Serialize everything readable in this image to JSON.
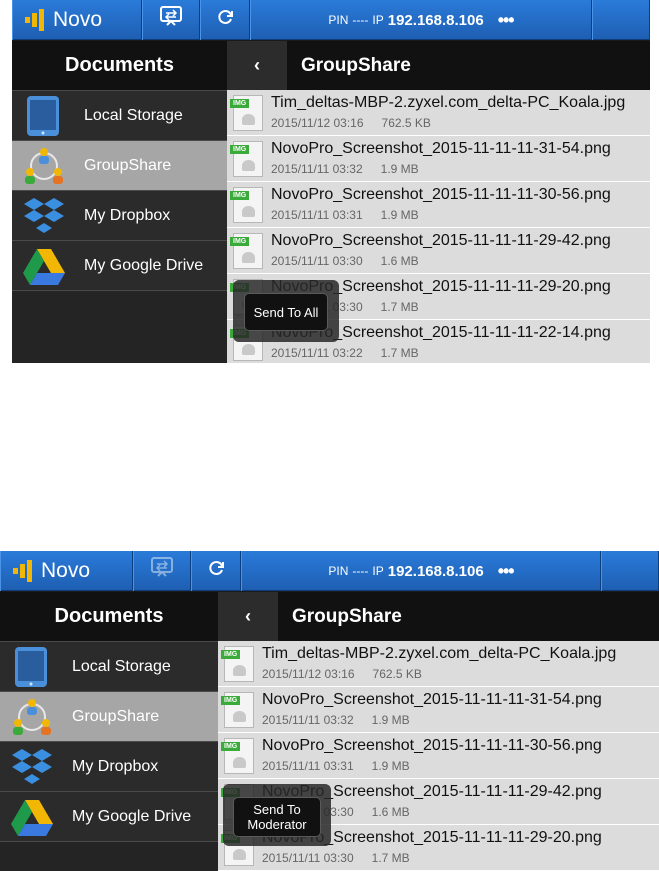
{
  "shots": [
    {
      "app_name": "Novo",
      "status": {
        "pin_label": "PIN",
        "pin_value": "----",
        "ip_label": "IP",
        "ip_value": "192.168.8.106",
        "more": "•••"
      },
      "sidebar": {
        "title": "Documents",
        "items": [
          {
            "label": "Local Storage",
            "icon": "tablet-icon",
            "selected": false
          },
          {
            "label": "GroupShare",
            "icon": "group-share-icon",
            "selected": true
          },
          {
            "label": "My Dropbox",
            "icon": "dropbox-icon",
            "selected": false
          },
          {
            "label": "My Google Drive",
            "icon": "google-drive-icon",
            "selected": false
          }
        ]
      },
      "main": {
        "back": "‹",
        "title": "GroupShare",
        "files": [
          {
            "name": "Tim_deltas-MBP-2.zyxel.com_delta-PC_Koala.jpg",
            "date": "2015/11/12 03:16",
            "size": "762.5 KB"
          },
          {
            "name": "NovoPro_Screenshot_2015-11-11-11-31-54.png",
            "date": "2015/11/11 03:32",
            "size": "1.9 MB"
          },
          {
            "name": "NovoPro_Screenshot_2015-11-11-11-30-56.png",
            "date": "2015/11/11 03:31",
            "size": "1.9 MB"
          },
          {
            "name": "NovoPro_Screenshot_2015-11-11-11-29-42.png",
            "date": "2015/11/11 03:30",
            "size": "1.6 MB"
          },
          {
            "name": "NovoPro_Screenshot_2015-11-11-11-29-20.png",
            "date": "2015/11/11 03:30",
            "size": "1.7 MB"
          },
          {
            "name": "NovoPro_Screenshot_2015-11-11-11-22-14.png",
            "date": "2015/11/11 03:22",
            "size": "1.7 MB"
          }
        ]
      },
      "popup_label": "Send To All"
    },
    {
      "app_name": "Novo",
      "status": {
        "pin_label": "PIN",
        "pin_value": "----",
        "ip_label": "IP",
        "ip_value": "192.168.8.106",
        "more": "•••"
      },
      "sidebar": {
        "title": "Documents",
        "items": [
          {
            "label": "Local Storage",
            "icon": "tablet-icon",
            "selected": false
          },
          {
            "label": "GroupShare",
            "icon": "group-share-icon",
            "selected": true
          },
          {
            "label": "My Dropbox",
            "icon": "dropbox-icon",
            "selected": false
          },
          {
            "label": "My Google Drive",
            "icon": "google-drive-icon",
            "selected": false
          }
        ]
      },
      "main": {
        "back": "‹",
        "title": "GroupShare",
        "files": [
          {
            "name": "Tim_deltas-MBP-2.zyxel.com_delta-PC_Koala.jpg",
            "date": "2015/11/12 03:16",
            "size": "762.5 KB"
          },
          {
            "name": "NovoPro_Screenshot_2015-11-11-11-31-54.png",
            "date": "2015/11/11 03:32",
            "size": "1.9 MB"
          },
          {
            "name": "NovoPro_Screenshot_2015-11-11-11-30-56.png",
            "date": "2015/11/11 03:31",
            "size": "1.9 MB"
          },
          {
            "name": "NovoPro_Screenshot_2015-11-11-11-29-42.png",
            "date": "2015/11/11 03:30",
            "size": "1.6 MB"
          },
          {
            "name": "NovoPro_Screenshot_2015-11-11-11-29-20.png",
            "date": "2015/11/11 03:30",
            "size": "1.7 MB"
          }
        ]
      },
      "popup_label": "Send To Moderator"
    }
  ],
  "colors": {
    "topbar": "#1e5fb3",
    "selected_item": "#a6a6a6",
    "file_row": "#dcdcdc",
    "img_tag": "#3aaa3a",
    "logo": "#f2b705"
  }
}
